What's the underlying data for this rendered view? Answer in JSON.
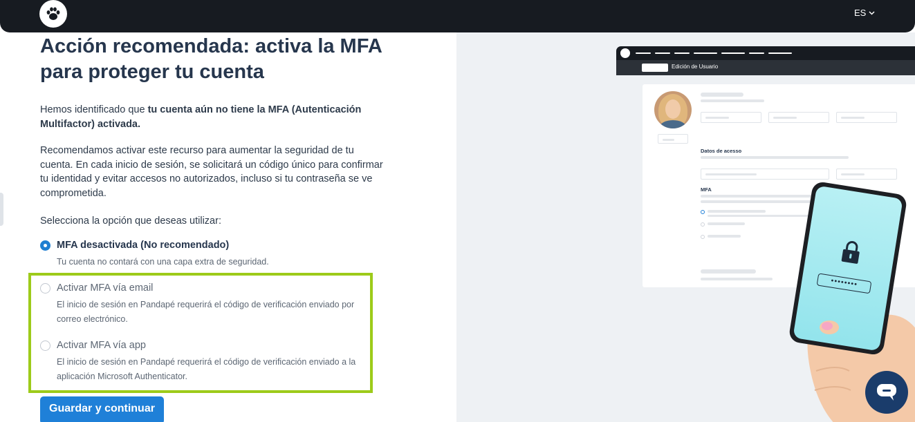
{
  "header": {
    "logo_icon": "paw-icon",
    "language": "ES"
  },
  "main": {
    "title": "Acción recomendada: activa la MFA para proteger tu cuenta",
    "intro_prefix": "Hemos identificado que ",
    "intro_bold": "tu cuenta aún no tiene la MFA (Autenticación Multifactor) activada.",
    "description": "Recomendamos activar este recurso para aumentar la seguridad de tu cuenta. En cada inicio de sesión, se solicitará un código único para confirmar tu identidad y evitar accesos no autorizados, incluso si tu contraseña se ve comprometida.",
    "select_prompt": "Selecciona la opción que deseas utilizar:",
    "options": [
      {
        "label": "MFA desactivada (No recomendado)",
        "description": "Tu cuenta no contará con una capa extra de seguridad.",
        "selected": true
      },
      {
        "label": "Activar MFA vía email",
        "description": "El inicio de sesión en Pandapé requerirá el código de verificación enviado por correo electrónico.",
        "selected": false
      },
      {
        "label": "Activar MFA vía app",
        "description": "El inicio de sesión en Pandapé requerirá el código de verificación enviado a la aplicación Microsoft Authenticator.",
        "selected": false
      }
    ],
    "save_label": "Guardar y continuar"
  },
  "illustration": {
    "section_title": "Edición de Usuario",
    "access_label": "Datos de acesso",
    "mfa_label": "MFA",
    "password_mask": "••••••••"
  },
  "colors": {
    "topbar": "#171b21",
    "primary": "#1f80d8",
    "highlight": "#9dcb1a",
    "chat": "#1a3c6b"
  }
}
